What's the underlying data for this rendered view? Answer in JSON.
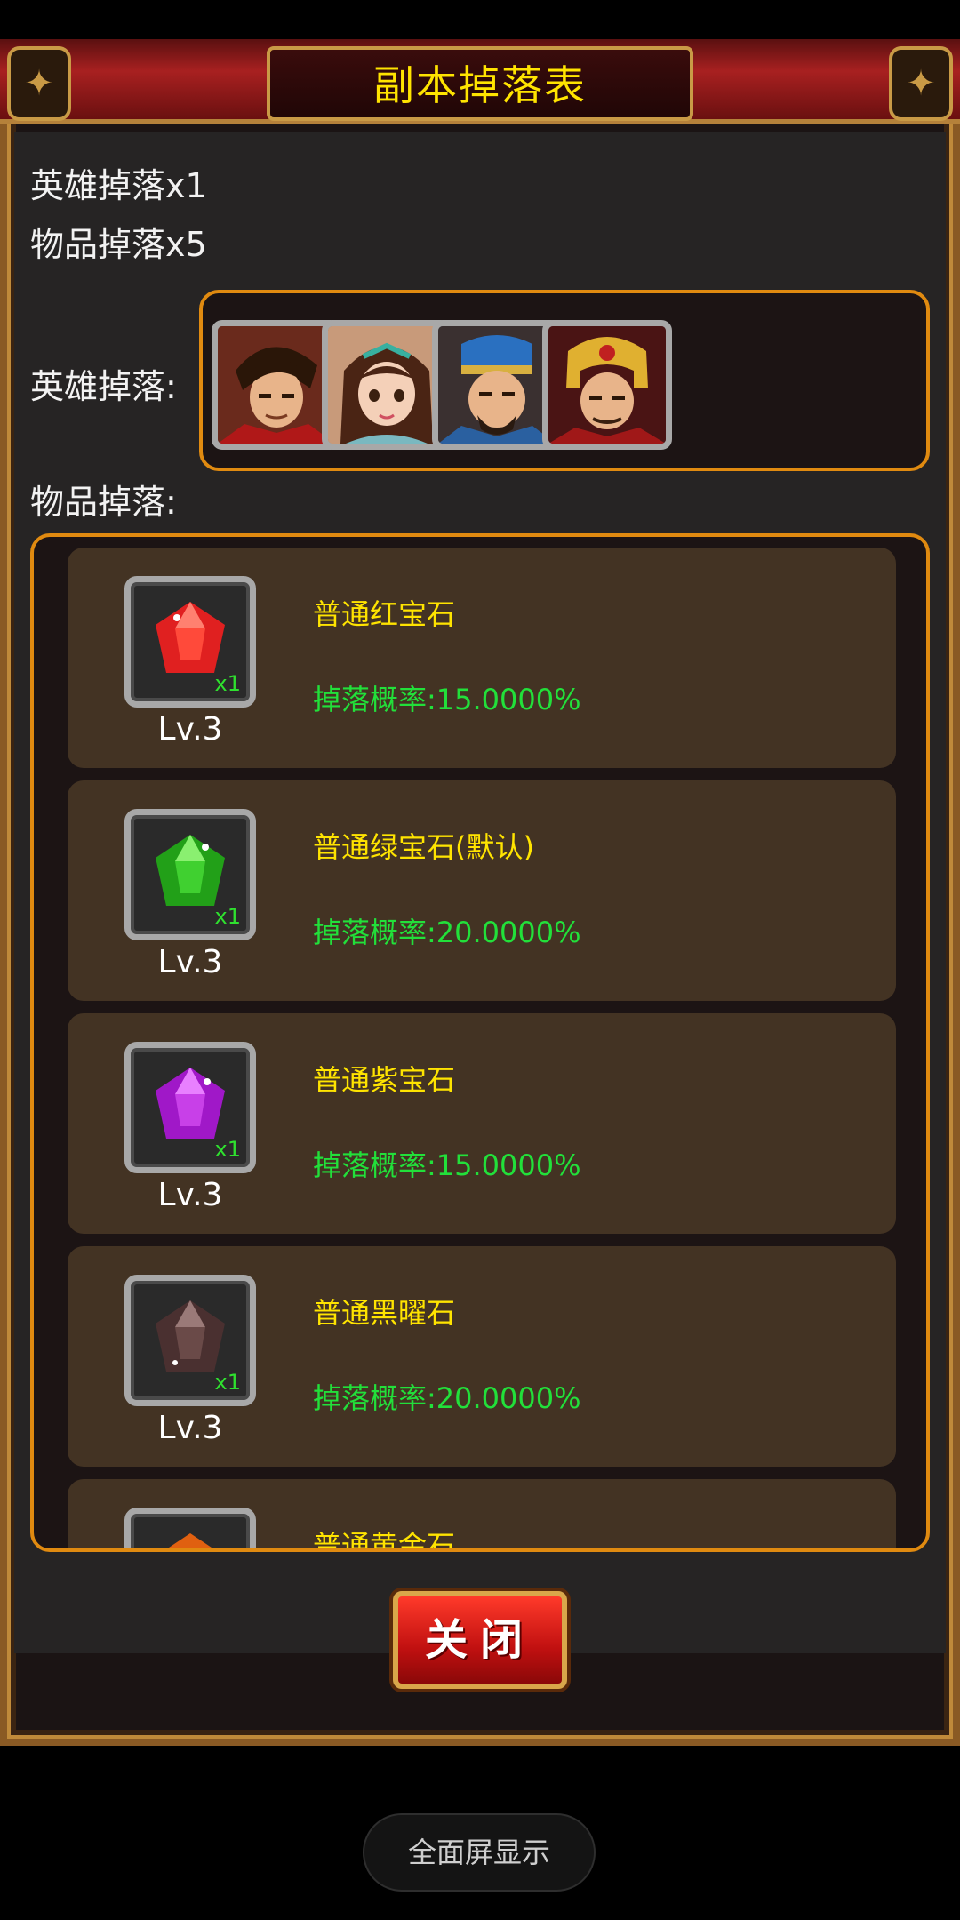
{
  "dialog": {
    "title": "副本掉落表",
    "hero_drop_summary": "英雄掉落x1",
    "item_drop_summary": "物品掉落x5",
    "hero_drop_label": "英雄掉落:",
    "item_drop_label": "物品掉落:",
    "heroes": [
      {
        "icon": "hero-portrait-warrior-icon"
      },
      {
        "icon": "hero-portrait-lady-icon"
      },
      {
        "icon": "hero-portrait-blue-hat-icon"
      },
      {
        "icon": "hero-portrait-gold-helmet-icon"
      }
    ],
    "items": [
      {
        "name": "普通红宝石",
        "rate": "掉落概率:15.0000%",
        "level": "Lv.3",
        "qty": "x1",
        "gem_color": "#e02020"
      },
      {
        "name": "普通绿宝石(默认)",
        "rate": "掉落概率:20.0000%",
        "level": "Lv.3",
        "qty": "x1",
        "gem_color": "#30c020"
      },
      {
        "name": "普通紫宝石",
        "rate": "掉落概率:15.0000%",
        "level": "Lv.3",
        "qty": "x1",
        "gem_color": "#b020d0"
      },
      {
        "name": "普通黑曜石",
        "rate": "掉落概率:20.0000%",
        "level": "Lv.3",
        "qty": "x1",
        "gem_color": "#5a3a3a"
      },
      {
        "name": "普通黄金石",
        "rate": "",
        "level": "",
        "qty": "",
        "gem_color": "#e06010"
      }
    ],
    "close_label": "关闭"
  },
  "system": {
    "fullscreen_label": "全面屏显示"
  },
  "colors": {
    "title_text": "#ffe400",
    "item_name": "#ffe400",
    "drop_rate": "#22e03a",
    "box_border": "#e08a10",
    "card_bg": "#433323"
  }
}
